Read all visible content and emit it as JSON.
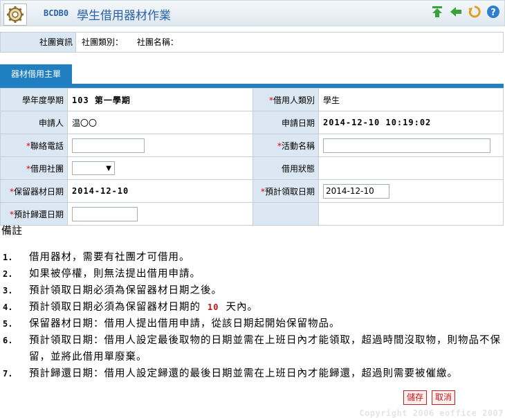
{
  "header": {
    "code": "BCDB0",
    "title": "學生借用器材作業",
    "tools": [
      "up-arrow-icon",
      "back-arrow-icon",
      "refresh-icon",
      "help-icon"
    ]
  },
  "club": {
    "label": "社團資訊",
    "type_label": "社團類別：",
    "name_label": "社團名稱："
  },
  "tab": {
    "label": "器材借用主單"
  },
  "form": {
    "term_label": "學年度學期",
    "term_value": "103 第一學期",
    "borrower_type_label": "借用人類別",
    "borrower_type_value": "學生",
    "applicant_label": "申請人",
    "applicant_value": "温〇〇",
    "apply_date_label": "申請日期",
    "apply_date_value": "2014-12-10 10:19:02",
    "phone_label": "聯絡電話",
    "phone_value": "",
    "event_label": "活動名稱",
    "event_value": "",
    "borrow_club_label": "借用社團",
    "borrow_club_value": "",
    "borrow_status_label": "借用狀態",
    "reserve_date_label": "保留器材日期",
    "reserve_date_value": "2014-12-10",
    "pickup_date_label": "預計領取日期",
    "pickup_date_value": "2014-12-10",
    "return_date_label": "預計歸還日期",
    "return_date_value": ""
  },
  "notes": {
    "title": "備註",
    "items": [
      {
        "num": "1.",
        "text": "借用器材，需要有社團才可借用。"
      },
      {
        "num": "2.",
        "text": "如果被停權，則無法提出借用申請。"
      },
      {
        "num": "3.",
        "text": "預計領取日期必須為保留器材日期之後。"
      },
      {
        "num": "4.",
        "pre": "預計領取日期必須為保留器材日期的",
        "highlight": "10",
        "post": "天內。"
      },
      {
        "num": "5.",
        "text": "保留器材日期：借用人提出借用申請，從該日期起開始保留物品。"
      },
      {
        "num": "6.",
        "text": "預計領取日期：借用人設定最後取物的日期並需在上班日內才能領取，超過時間沒取物，則物品不保留，並將此借用單廢棄。"
      },
      {
        "num": "7.",
        "text": "預計歸還日期：借用人設定歸還的最後日期並需在上班日內才能歸還，超過則需要被催繳。"
      }
    ]
  },
  "buttons": {
    "save": "儲存",
    "cancel": "取消"
  },
  "footer": {
    "copyright": "Copyright 2006 eoffice 2007"
  },
  "colors": {
    "accent": "#1f7fc0",
    "label_bg": "#dbe8f3",
    "required": "#dd0000",
    "button": "#c01818"
  }
}
